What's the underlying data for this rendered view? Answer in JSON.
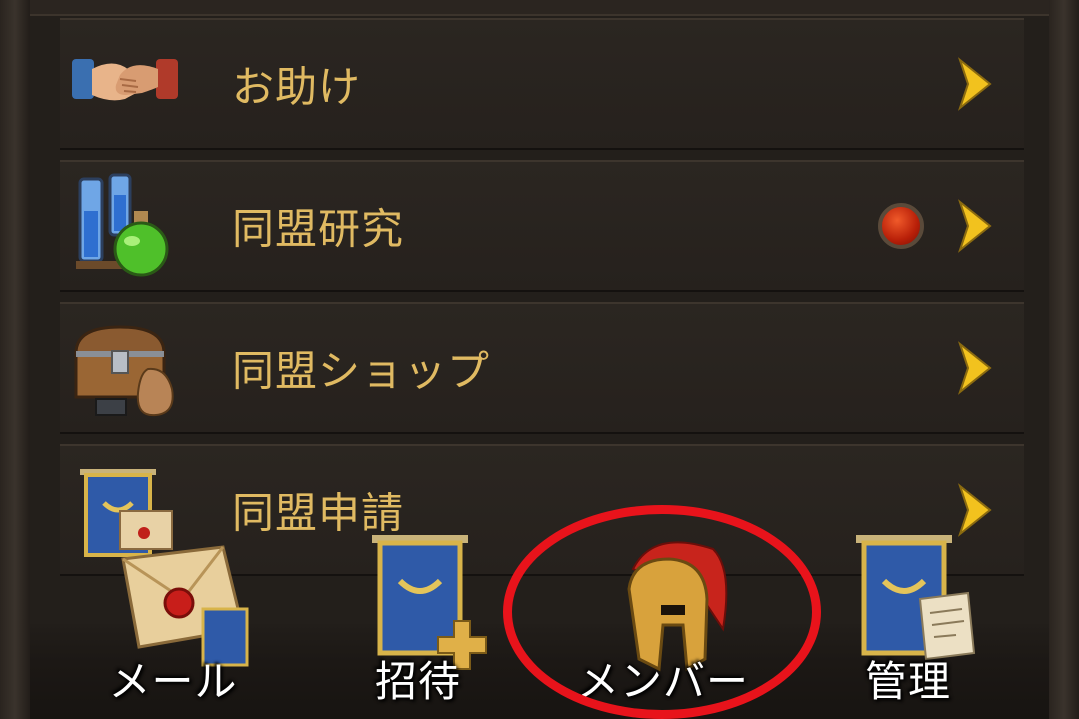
{
  "menu": {
    "items": [
      {
        "label": "お助け",
        "icon": "handshake-icon",
        "badge": false
      },
      {
        "label": "同盟研究",
        "icon": "potion-flasks-icon",
        "badge": true
      },
      {
        "label": "同盟ショップ",
        "icon": "treasure-chest-icon",
        "badge": false
      },
      {
        "label": "同盟申請",
        "icon": "banner-letter-icon",
        "badge": false
      }
    ]
  },
  "bottom_nav": {
    "items": [
      {
        "label": "メール",
        "icon": "mail-envelope-icon"
      },
      {
        "label": "招待",
        "icon": "banner-plus-icon"
      },
      {
        "label": "メンバー",
        "icon": "spartan-helmet-icon"
      },
      {
        "label": "管理",
        "icon": "banner-scroll-icon"
      }
    ]
  },
  "colors": {
    "label_gold": "#e0ba62",
    "chevron_gold": "#f2c21e",
    "badge_red": "#c8200a",
    "highlight_red": "#e8131b",
    "banner_blue": "#2f5aa8"
  }
}
